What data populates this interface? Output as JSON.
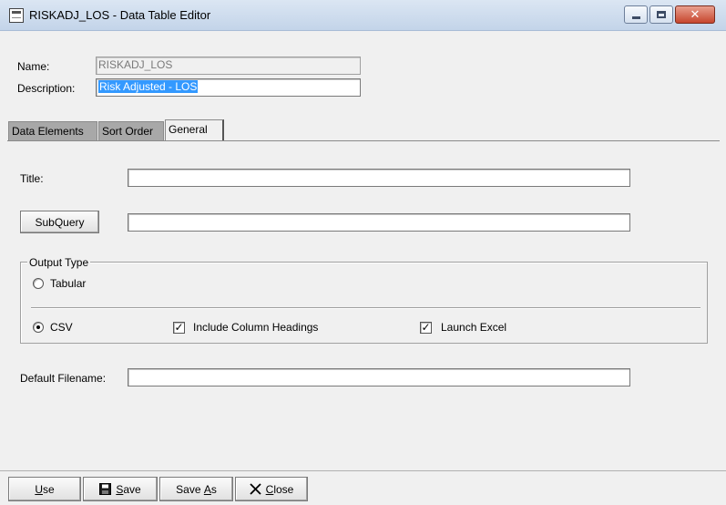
{
  "window": {
    "title": "RISKADJ_LOS - Data Table Editor"
  },
  "form": {
    "name_label": "Name:",
    "name_value": "RISKADJ_LOS",
    "description_label": "Description:",
    "description_value": "Risk Adjusted - LOS"
  },
  "tabs": [
    {
      "label": "Data Elements"
    },
    {
      "label": "Sort Order"
    },
    {
      "label": "General"
    }
  ],
  "general": {
    "title_label": "Title:",
    "title_value": "",
    "subquery_button": "SubQuery",
    "subquery_value": "",
    "output_type_legend": "Output Type",
    "tabular_label": "Tabular",
    "csv_label": "CSV",
    "include_headings_label": "Include Column Headings",
    "launch_excel_label": "Launch Excel",
    "default_filename_label": "Default Filename:",
    "default_filename_value": ""
  },
  "state": {
    "tabular": false,
    "csv": true,
    "include_headings": true,
    "launch_excel": true
  },
  "toolbar": {
    "use_mnemonic": "U",
    "use_rest": "se",
    "save_mnemonic": "S",
    "save_rest": "ave",
    "saveas_prefix": "Save ",
    "saveas_mnemonic": "A",
    "saveas_rest": "s",
    "close_mnemonic": "C",
    "close_rest": "lose"
  },
  "icons": {
    "save": "floppy-disk-icon",
    "close": "x-icon",
    "app": "table-icon"
  }
}
